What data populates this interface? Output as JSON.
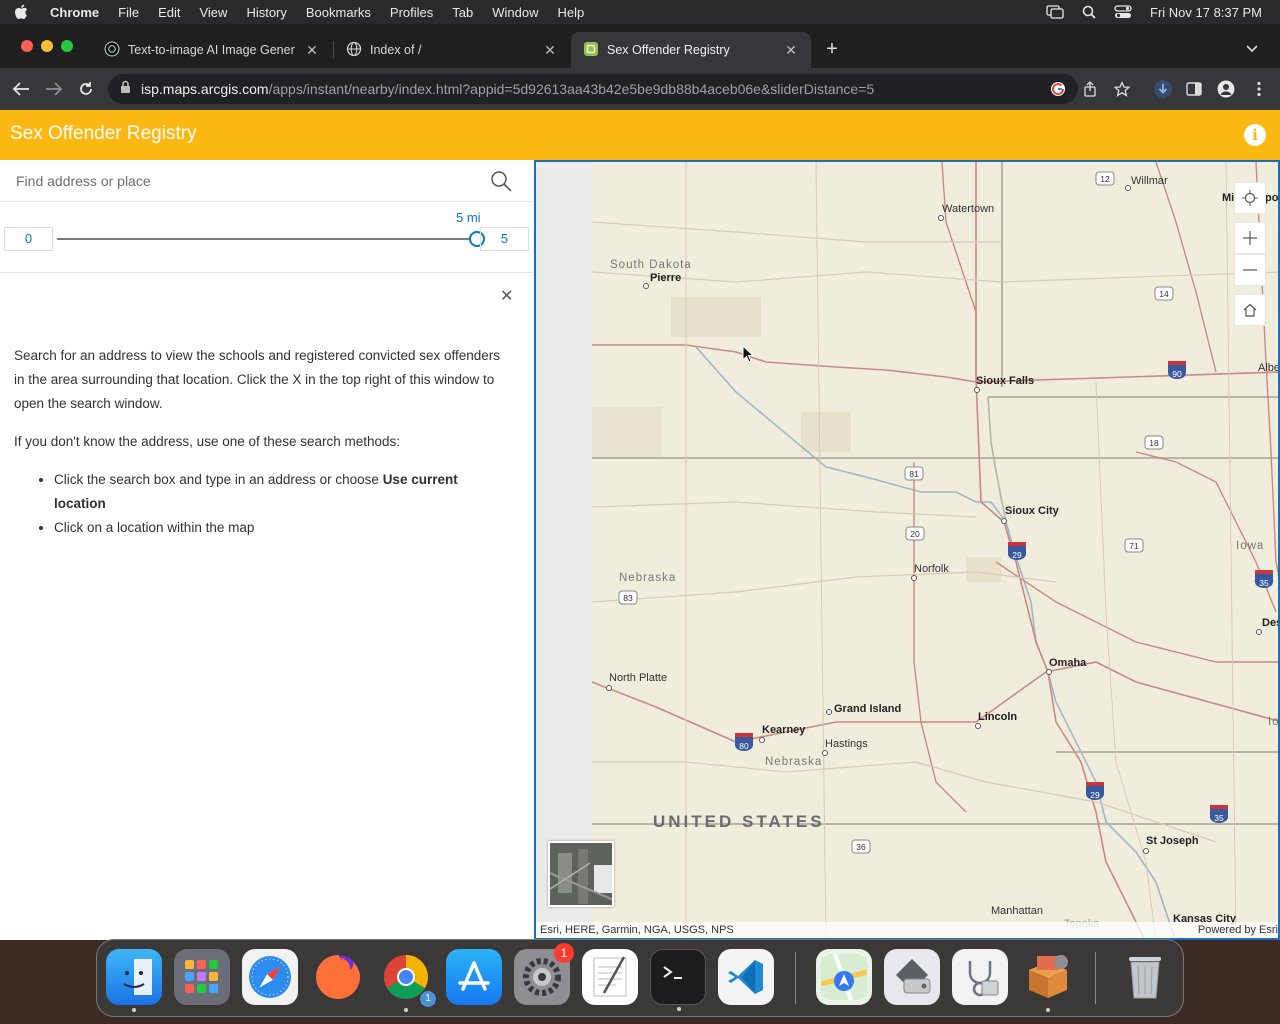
{
  "menubar": {
    "app_name": "Chrome",
    "items": [
      "File",
      "Edit",
      "View",
      "History",
      "Bookmarks",
      "Profiles",
      "Tab",
      "Window",
      "Help"
    ],
    "clock": "Fri Nov 17  8:37 PM"
  },
  "tabs": [
    {
      "title": "Text-to-image AI Image Gener",
      "icon": "openai-icon",
      "active": false
    },
    {
      "title": "Index of /",
      "icon": "globe-icon",
      "active": false
    },
    {
      "title": "Sex Offender Registry",
      "icon": "arcgis-icon",
      "active": true
    }
  ],
  "address_bar": {
    "host": "isp.maps.arcgis.com",
    "path": "/apps/instant/nearby/index.html?appid=5d92613aa43b42e5be9db88b4aceb06e&sliderDistance=5"
  },
  "app": {
    "title": "Sex Offender Registry",
    "search_placeholder": "Find address or place",
    "slider": {
      "min": "0",
      "max": "5",
      "current_label": "5 mi",
      "value_fraction": 1.0
    },
    "intro": {
      "p1": "Search for an address to view the schools and registered convicted sex offenders in the area surrounding that location. Click the X in the top right of this window to open the search window.",
      "p2": "If you don't know the address, use one of these search methods:",
      "bullet1_pre": "Click the search box and type in an address or choose ",
      "bullet1_bold": "Use current location",
      "bullet2": "Click on a location within the map"
    }
  },
  "map": {
    "labels": {
      "south_dakota": "South Dakota",
      "pierre": "Pierre",
      "watertown": "Watertown",
      "willmar": "Willmar",
      "sioux_falls": "Sioux Falls",
      "sioux_city": "Sioux City",
      "norfolk": "Norfolk",
      "nebraska_n": "Nebraska",
      "nebraska_s": "Nebraska",
      "north_platte": "North Platte",
      "grand_island": "Grand Island",
      "kearney": "Kearney",
      "hastings": "Hastings",
      "omaha": "Omaha",
      "lincoln": "Lincoln",
      "st_joseph": "St Joseph",
      "manhattan": "Manhattan",
      "kansas_city": "Kansas City",
      "topeka": "Topeka",
      "iowa": "Iowa",
      "iowa2": "Iow",
      "des": "Des",
      "mi": "Mi",
      "po": "po",
      "albe": "Albe",
      "us": "UNITED STATES"
    },
    "shields": {
      "s12": "12",
      "s14": "14",
      "s90": "90",
      "s18": "18",
      "s81": "81",
      "s20": "20",
      "s29a": "29",
      "s71": "71",
      "s35a": "35",
      "s83": "83",
      "s80": "80",
      "s29b": "29",
      "s35b": "35",
      "s36": "36"
    },
    "attribution": "Esri, HERE, Garmin, NGA, USGS, NPS",
    "powered_by": "Powered by Esri"
  },
  "colors": {
    "app_bar": "#fdb813",
    "accent": "#007ac2",
    "map_border": "#1a6fb8"
  }
}
